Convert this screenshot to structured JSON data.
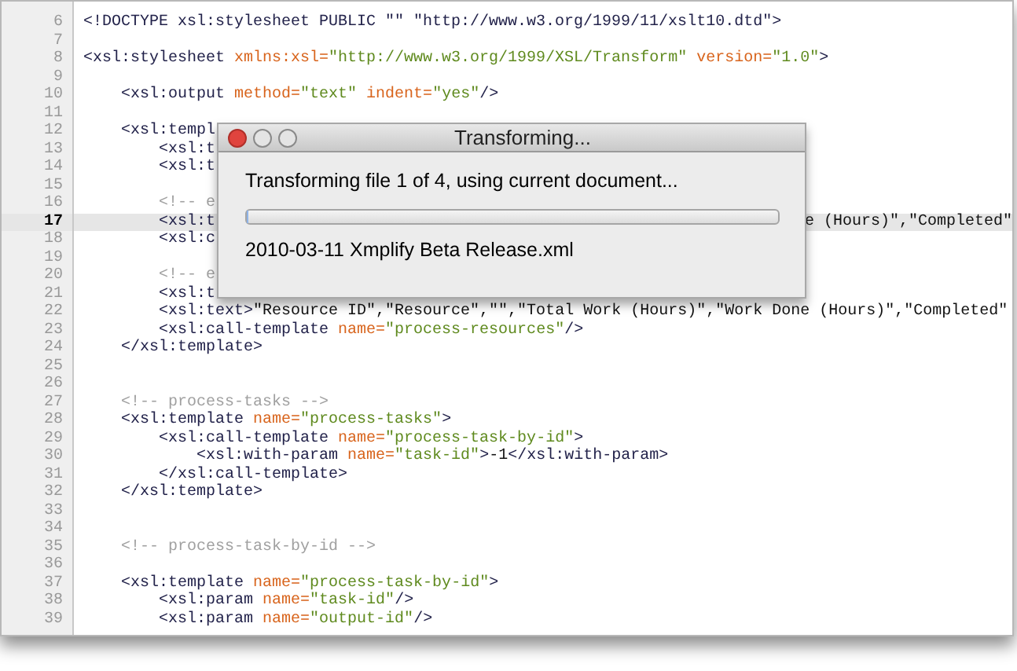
{
  "editor": {
    "lines": [
      {
        "number": "6",
        "current": false,
        "tokens": [
          {
            "kind": "tag",
            "text": "<!DOCTYPE xsl:stylesheet PUBLIC \"\" \"http://www.w3.org/1999/11/xslt10.dtd\">"
          }
        ]
      },
      {
        "number": "7",
        "current": false
      },
      {
        "number": "8",
        "current": false,
        "tokens": [
          {
            "kind": "tag",
            "text": "<xsl:stylesheet "
          },
          {
            "kind": "attr",
            "text": "xmlns:xsl="
          },
          {
            "kind": "value",
            "text": "\"http://www.w3.org/1999/XSL/Transform\""
          },
          {
            "kind": "attr",
            "text": " version="
          },
          {
            "kind": "value",
            "text": "\"1.0\""
          },
          {
            "kind": "tag",
            "text": ">"
          }
        ]
      },
      {
        "number": "9",
        "current": false
      },
      {
        "number": "10",
        "current": false,
        "tokens": [
          {
            "kind": "tag",
            "text": "    <xsl:output "
          },
          {
            "kind": "attr",
            "text": "method="
          },
          {
            "kind": "value",
            "text": "\"text\""
          },
          {
            "kind": "attr",
            "text": " indent="
          },
          {
            "kind": "value",
            "text": "\"yes\""
          },
          {
            "kind": "tag",
            "text": "/>"
          }
        ]
      },
      {
        "number": "11",
        "current": false
      },
      {
        "number": "12",
        "current": false,
        "tokens": [
          {
            "kind": "tag",
            "text": "    <xsl:templ"
          }
        ]
      },
      {
        "number": "13",
        "current": false,
        "tokens": [
          {
            "kind": "tag",
            "text": "        <xsl:t"
          }
        ]
      },
      {
        "number": "14",
        "current": false,
        "tokens": [
          {
            "kind": "tag",
            "text": "        <xsl:t"
          }
        ]
      },
      {
        "number": "15",
        "current": false
      },
      {
        "number": "16",
        "current": false,
        "tokens": [
          {
            "kind": "comment",
            "text": "        <!-- e"
          }
        ]
      },
      {
        "number": "17",
        "current": true,
        "tokens": [
          {
            "kind": "tag",
            "text": "        <xsl:t"
          }
        ],
        "right_tokens": [
          {
            "kind": "text",
            "text": "e (Hours)\",\"Completed\""
          }
        ]
      },
      {
        "number": "18",
        "current": false,
        "tokens": [
          {
            "kind": "tag",
            "text": "        <xsl:c"
          }
        ]
      },
      {
        "number": "19",
        "current": false
      },
      {
        "number": "20",
        "current": false,
        "tokens": [
          {
            "kind": "comment",
            "text": "        <!-- e"
          }
        ]
      },
      {
        "number": "21",
        "current": false,
        "tokens": [
          {
            "kind": "tag",
            "text": "        <xsl:t"
          }
        ]
      },
      {
        "number": "22",
        "current": false,
        "tokens": [
          {
            "kind": "tag",
            "text": "        <xsl:text>"
          },
          {
            "kind": "text",
            "text": "\"Resource ID\",\"Resource\",\"\",\"Total Work (Hours)\",\"Work Done (Hours)\",\"Completed\""
          }
        ]
      },
      {
        "number": "23",
        "current": false,
        "tokens": [
          {
            "kind": "tag",
            "text": "        <xsl:call-template "
          },
          {
            "kind": "attr",
            "text": "name="
          },
          {
            "kind": "value",
            "text": "\"process-resources\""
          },
          {
            "kind": "tag",
            "text": "/>"
          }
        ]
      },
      {
        "number": "24",
        "current": false,
        "tokens": [
          {
            "kind": "tag",
            "text": "    </xsl:template>"
          }
        ]
      },
      {
        "number": "25",
        "current": false
      },
      {
        "number": "26",
        "current": false
      },
      {
        "number": "27",
        "current": false,
        "tokens": [
          {
            "kind": "comment",
            "text": "    <!-- process-tasks -->"
          }
        ]
      },
      {
        "number": "28",
        "current": false,
        "tokens": [
          {
            "kind": "tag",
            "text": "    <xsl:template "
          },
          {
            "kind": "attr",
            "text": "name="
          },
          {
            "kind": "value",
            "text": "\"process-tasks\""
          },
          {
            "kind": "tag",
            "text": ">"
          }
        ]
      },
      {
        "number": "29",
        "current": false,
        "tokens": [
          {
            "kind": "tag",
            "text": "        <xsl:call-template "
          },
          {
            "kind": "attr",
            "text": "name="
          },
          {
            "kind": "value",
            "text": "\"process-task-by-id\""
          },
          {
            "kind": "tag",
            "text": ">"
          }
        ]
      },
      {
        "number": "30",
        "current": false,
        "tokens": [
          {
            "kind": "tag",
            "text": "            <xsl:with-param "
          },
          {
            "kind": "attr",
            "text": "name="
          },
          {
            "kind": "value",
            "text": "\"task-id\""
          },
          {
            "kind": "tag",
            "text": ">"
          },
          {
            "kind": "text",
            "text": "-1"
          },
          {
            "kind": "tag",
            "text": "</xsl:with-param>"
          }
        ]
      },
      {
        "number": "31",
        "current": false,
        "tokens": [
          {
            "kind": "tag",
            "text": "        </xsl:call-template>"
          }
        ]
      },
      {
        "number": "32",
        "current": false,
        "tokens": [
          {
            "kind": "tag",
            "text": "    </xsl:template>"
          }
        ]
      },
      {
        "number": "33",
        "current": false
      },
      {
        "number": "34",
        "current": false
      },
      {
        "number": "35",
        "current": false,
        "tokens": [
          {
            "kind": "comment",
            "text": "    <!-- process-task-by-id -->"
          }
        ]
      },
      {
        "number": "36",
        "current": false
      },
      {
        "number": "37",
        "current": false,
        "tokens": [
          {
            "kind": "tag",
            "text": "    <xsl:template "
          },
          {
            "kind": "attr",
            "text": "name="
          },
          {
            "kind": "value",
            "text": "\"process-task-by-id\""
          },
          {
            "kind": "tag",
            "text": ">"
          }
        ]
      },
      {
        "number": "38",
        "current": false,
        "tokens": [
          {
            "kind": "tag",
            "text": "        <xsl:param "
          },
          {
            "kind": "attr",
            "text": "name="
          },
          {
            "kind": "value",
            "text": "\"task-id\""
          },
          {
            "kind": "tag",
            "text": "/>"
          }
        ]
      },
      {
        "number": "39",
        "current": false,
        "tokens": [
          {
            "kind": "tag",
            "text": "        <xsl:param "
          },
          {
            "kind": "attr",
            "text": "name="
          },
          {
            "kind": "value",
            "text": "\"output-id\""
          },
          {
            "kind": "tag",
            "text": "/>"
          }
        ]
      }
    ]
  },
  "dialog": {
    "title": "Transforming...",
    "message": "Transforming file 1 of 4, using current document...",
    "progress": {
      "level": 0
    },
    "file": "2010-03-11 Xmplify Beta Release.xml"
  }
}
